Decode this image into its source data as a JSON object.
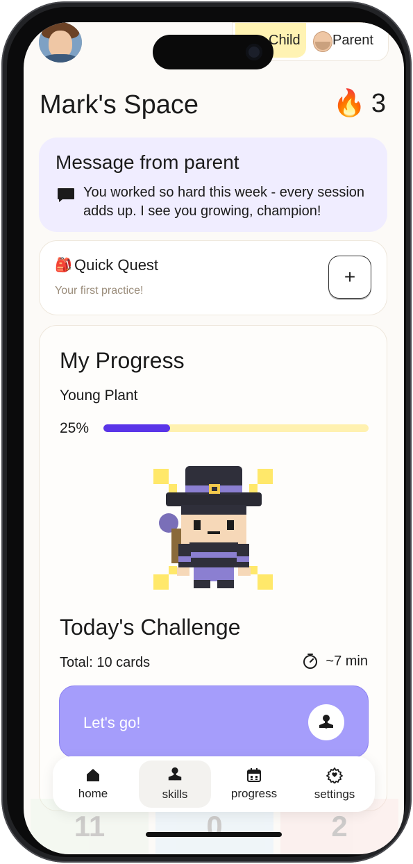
{
  "header": {
    "title": "Mark's Space",
    "streak_count": "3",
    "streak_icon": "fire-icon"
  },
  "role_switch": {
    "child_label": "Child",
    "parent_label": "Parent",
    "selected": "Child"
  },
  "message_card": {
    "title": "Message from parent",
    "text": "You worked so hard this week - every session adds up. I see you growing, champion!"
  },
  "quest_card": {
    "title": "Quick Quest",
    "subtitle": "Your first practice!",
    "add_label": "+"
  },
  "progress_card": {
    "title": "My Progress",
    "level": "Young Plant",
    "percent_label": "25%",
    "percent_value": 0.25
  },
  "challenge": {
    "title": "Today's Challenge",
    "total": "Total: 10 cards",
    "duration": "~7 min",
    "button_label": "Let's go!"
  },
  "nav": {
    "items": [
      {
        "label": "home",
        "icon": "home-icon"
      },
      {
        "label": "skills",
        "icon": "joystick-icon",
        "active": true
      },
      {
        "label": "progress",
        "icon": "calendar-icon"
      },
      {
        "label": "settings",
        "icon": "gear-icon"
      }
    ]
  },
  "peek_cards": [
    "11",
    "0",
    "2"
  ],
  "colors": {
    "accent": "#5a35e8",
    "button": "#a59dfb",
    "message_bg": "#f0edff",
    "child_bg": "#fff3b3"
  }
}
